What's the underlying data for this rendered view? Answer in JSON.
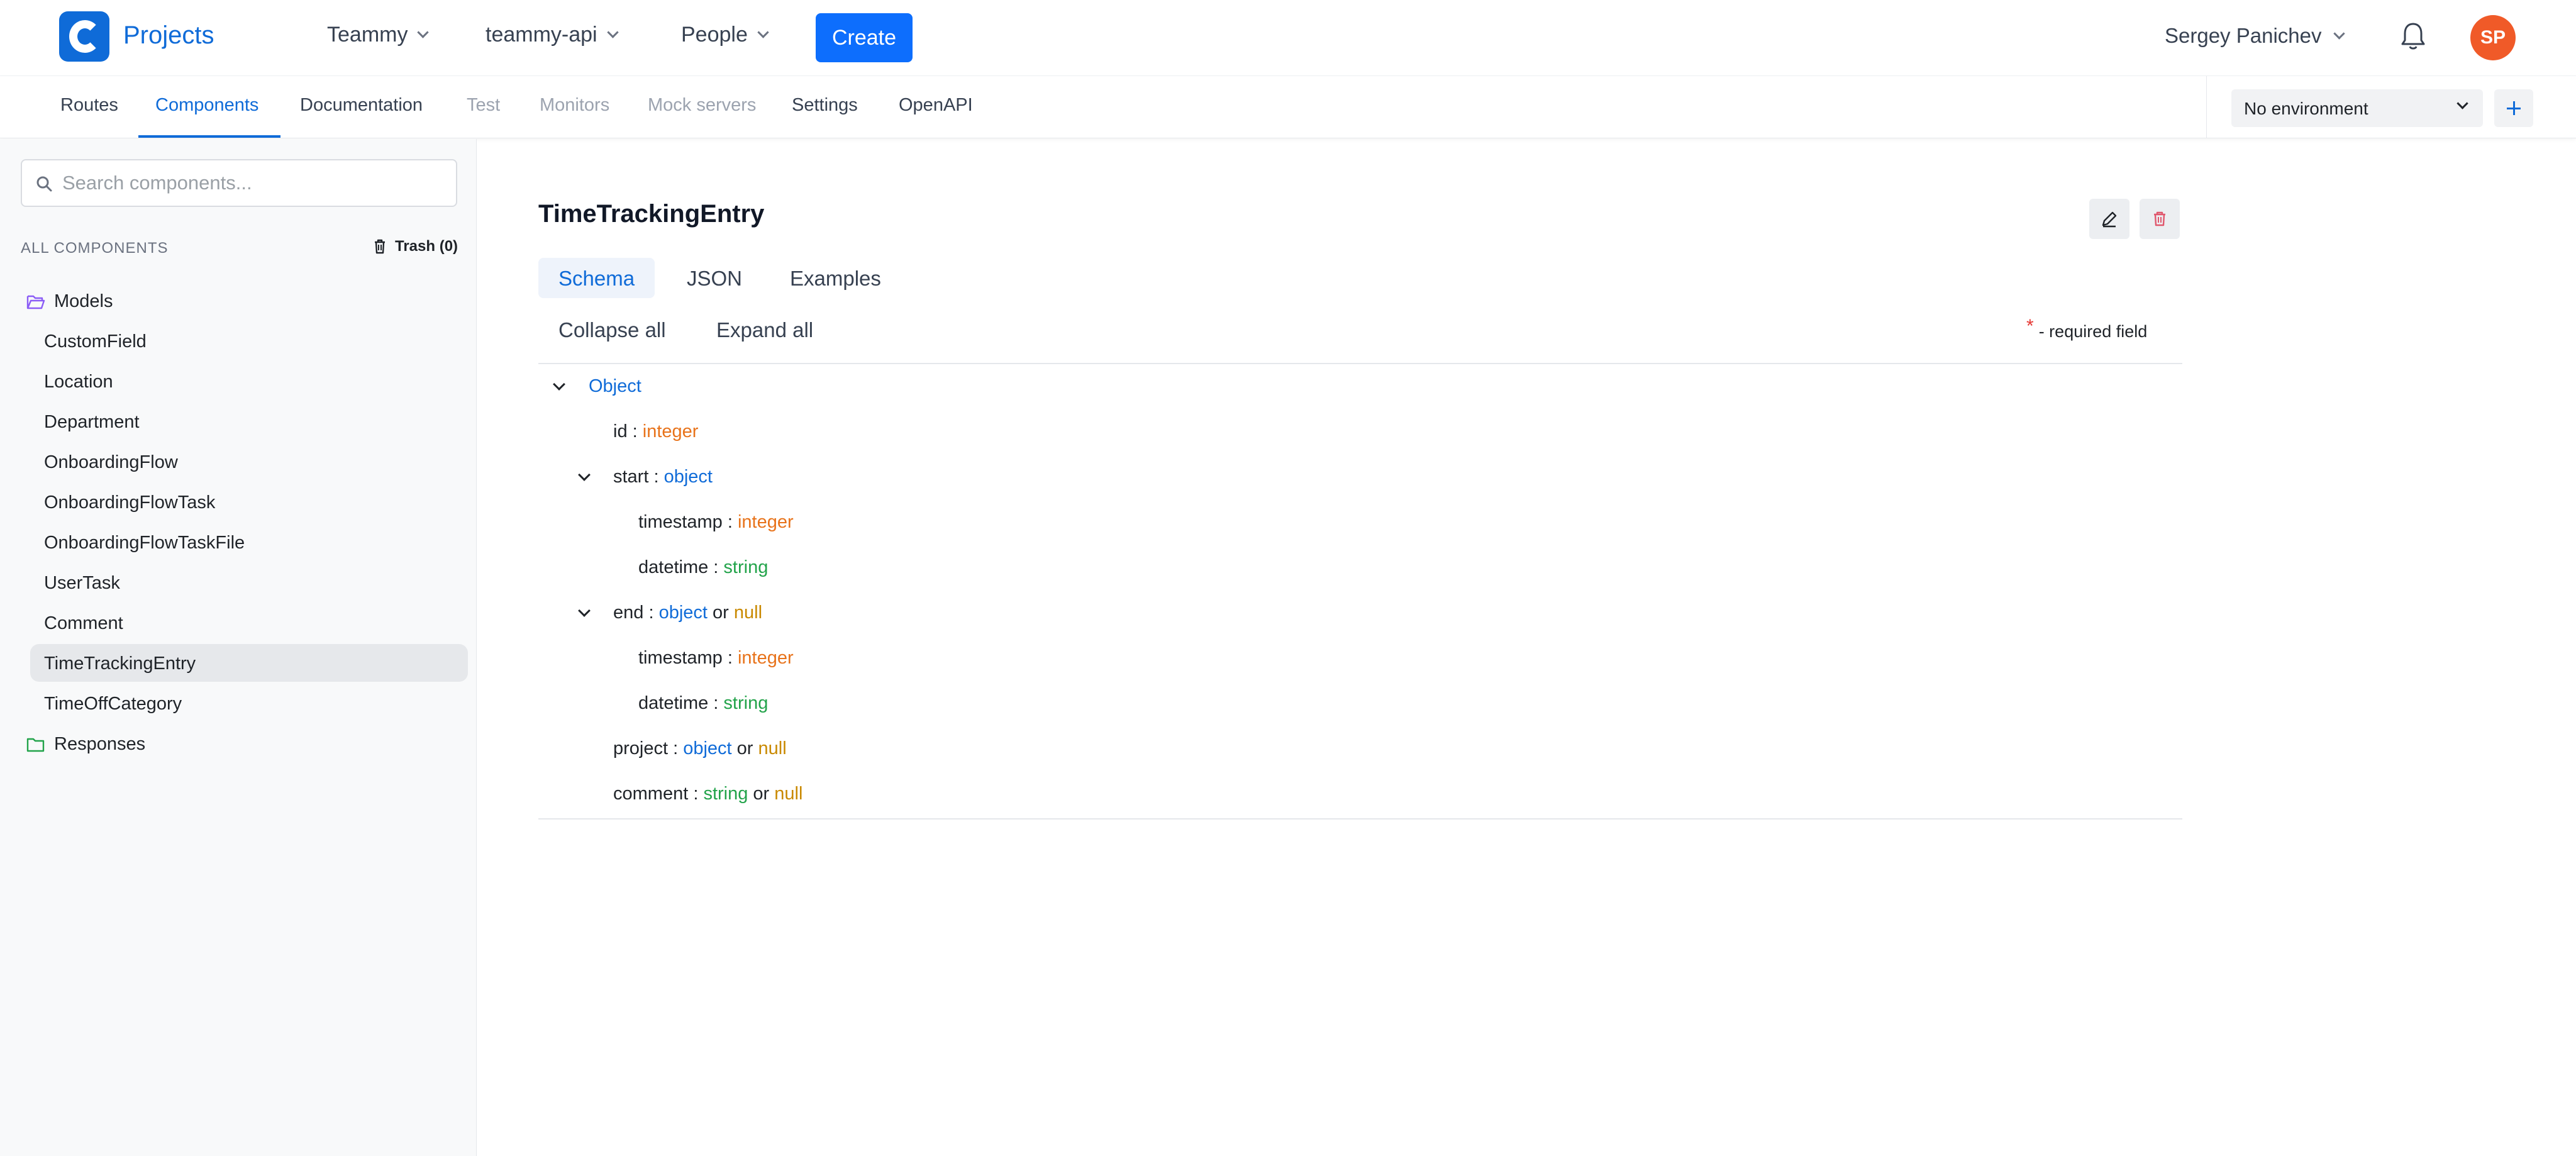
{
  "header": {
    "brand": "Projects",
    "nav": [
      "Teammy",
      "teammy-api",
      "People"
    ],
    "create_label": "Create",
    "user_name": "Sergey Panichev",
    "avatar_initials": "SP",
    "brand_color": "#0f6bd8",
    "avatar_color": "#f05a28"
  },
  "tabs": [
    {
      "label": "Routes",
      "state": "normal"
    },
    {
      "label": "Components",
      "state": "active"
    },
    {
      "label": "Documentation",
      "state": "normal"
    },
    {
      "label": "Test",
      "state": "disabled"
    },
    {
      "label": "Monitors",
      "state": "disabled"
    },
    {
      "label": "Mock servers",
      "state": "disabled"
    },
    {
      "label": "Settings",
      "state": "normal"
    },
    {
      "label": "OpenAPI",
      "state": "normal"
    }
  ],
  "environment": {
    "selected": "No environment"
  },
  "sidebar": {
    "search_placeholder": "Search components...",
    "section_title": "ALL COMPONENTS",
    "trash_label": "Trash (0)",
    "folders": {
      "models": "Models",
      "responses": "Responses"
    },
    "items": [
      "CustomField",
      "Location",
      "Department",
      "OnboardingFlow",
      "OnboardingFlowTask",
      "OnboardingFlowTaskFile",
      "UserTask",
      "Comment",
      "TimeTrackingEntry",
      "TimeOffCategory"
    ],
    "selected_item": "TimeTrackingEntry"
  },
  "main": {
    "title": "TimeTrackingEntry",
    "subtabs": [
      "Schema",
      "JSON",
      "Examples"
    ],
    "active_subtab": "Schema",
    "collapse_all": "Collapse all",
    "expand_all": "Expand all",
    "required_star": "*",
    "required_label": "- required field"
  },
  "schema": {
    "root": "Object",
    "or": "or",
    "sep": " : ",
    "fields": {
      "id": {
        "name": "id",
        "type": "integer"
      },
      "start": {
        "name": "start",
        "type": "object"
      },
      "start_timestamp": {
        "name": "timestamp",
        "type": "integer"
      },
      "start_datetime": {
        "name": "datetime",
        "type": "string"
      },
      "end": {
        "name": "end",
        "type": "object",
        "alt": "null"
      },
      "end_timestamp": {
        "name": "timestamp",
        "type": "integer"
      },
      "end_datetime": {
        "name": "datetime",
        "type": "string"
      },
      "project": {
        "name": "project",
        "type": "object",
        "alt": "null"
      },
      "comment": {
        "name": "comment",
        "type": "string",
        "alt": "null"
      }
    }
  },
  "colors": {
    "integer": "#e8731b",
    "object": "#0f6bd8",
    "string": "#22a34a",
    "null": "#c98900",
    "required": "#e53935"
  },
  "icons": [
    "logo-icon",
    "chevron-down-icon",
    "bell-icon",
    "plus-icon",
    "search-icon",
    "trash-icon",
    "folder-open-icon",
    "folder-icon",
    "edit-icon",
    "delete-icon"
  ]
}
